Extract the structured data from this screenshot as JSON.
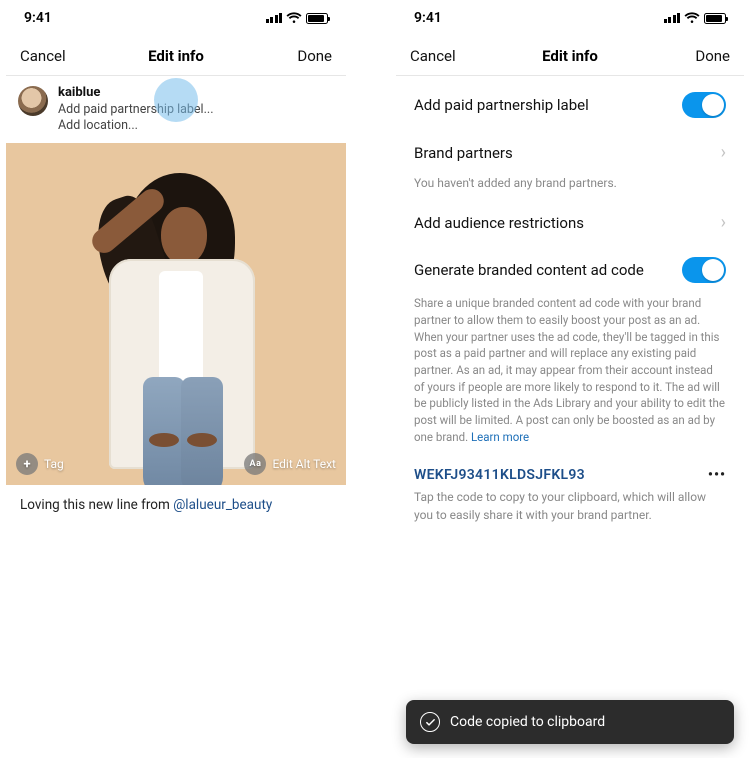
{
  "status": {
    "time": "9:41"
  },
  "left": {
    "nav": {
      "cancel": "Cancel",
      "title": "Edit info",
      "done": "Done"
    },
    "post": {
      "username": "kaiblue",
      "line1": "Add paid partnership label...",
      "line2": "Add location..."
    },
    "photo": {
      "tag_label": "Tag",
      "alt_label": "Edit Alt Text"
    },
    "caption_text": "Loving this new line from ",
    "caption_mention": "@lalueur_beauty"
  },
  "right": {
    "nav": {
      "cancel": "Cancel",
      "title": "Edit info",
      "done": "Done"
    },
    "rows": {
      "paid_label": "Add paid partnership label",
      "brand_partners": "Brand partners",
      "brand_partners_hint": "You haven't added any brand partners.",
      "audience": "Add audience restrictions",
      "generate": "Generate branded content ad code",
      "generate_hint": "Share a unique branded content ad code with your brand partner to allow them to easily boost your post as an ad. When your partner uses the ad code, they'll be tagged in this post as a paid partner and will replace any existing paid partner. As an ad, it may appear from their account instead of yours if people are more likely to respond to it. The ad will be publicly listed in the Ads Library and your ability to edit the post will be limited. A post can only be boosted as an ad by one brand. ",
      "generate_link": "Learn more",
      "code": "WEKFJ93411KLDSJFKL93",
      "code_hint": "Tap the code to copy to your clipboard, which will allow you to easily share it with your brand partner."
    },
    "toast": "Code copied to clipboard"
  }
}
